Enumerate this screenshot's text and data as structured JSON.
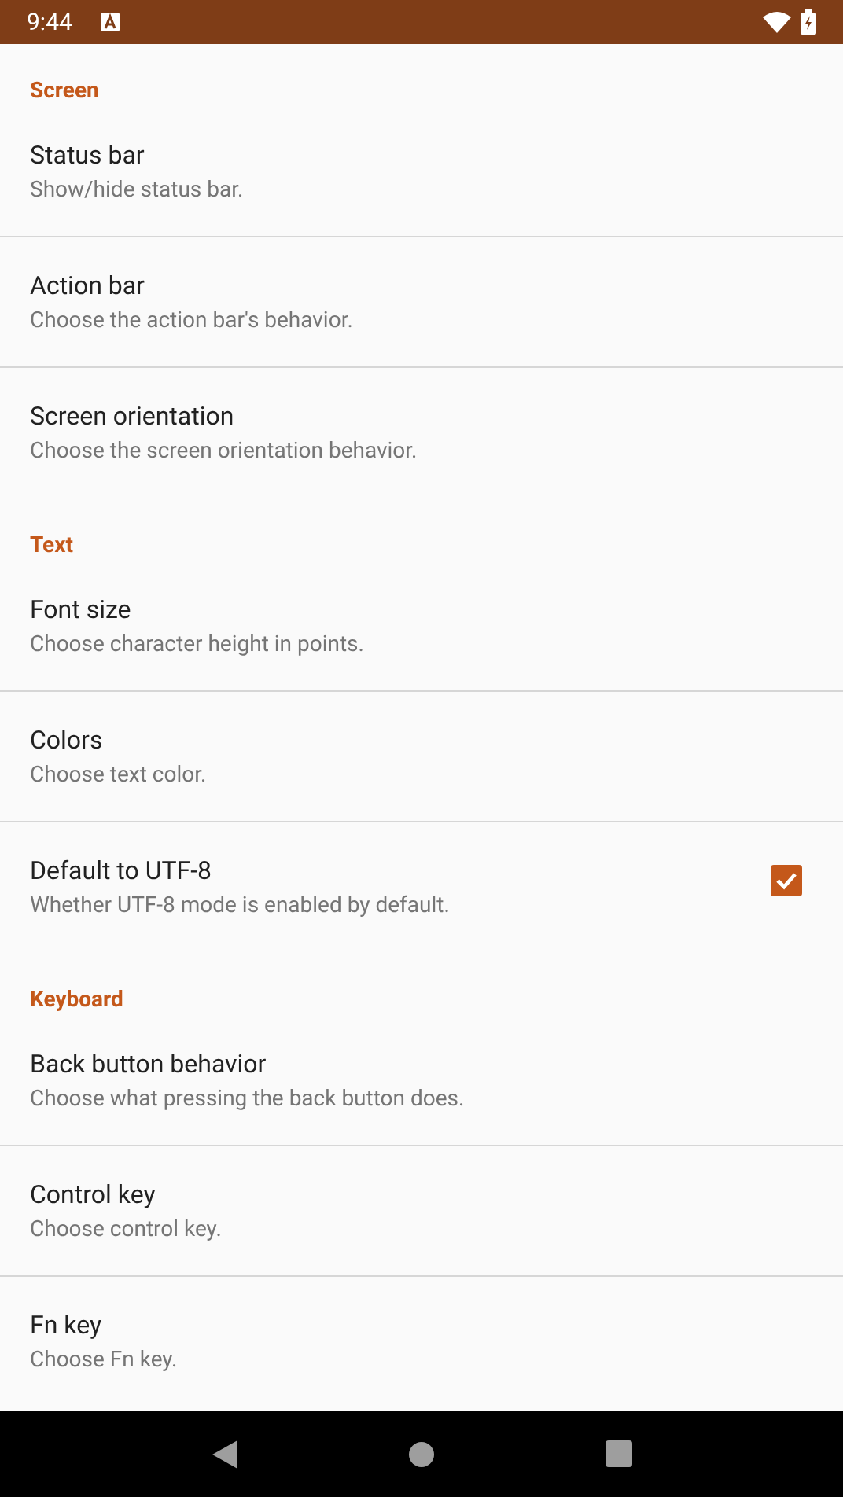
{
  "status_bar": {
    "time": "9:44"
  },
  "sections": [
    {
      "title": "Screen",
      "items": [
        {
          "kind": "plain",
          "title": "Status bar",
          "subtitle": "Show/hide status bar."
        },
        {
          "kind": "plain",
          "title": "Action bar",
          "subtitle": "Choose the action bar's behavior."
        },
        {
          "kind": "plain",
          "title": "Screen orientation",
          "subtitle": "Choose the screen orientation behavior."
        }
      ]
    },
    {
      "title": "Text",
      "items": [
        {
          "kind": "plain",
          "title": "Font size",
          "subtitle": "Choose character height in points."
        },
        {
          "kind": "plain",
          "title": "Colors",
          "subtitle": "Choose text color."
        },
        {
          "kind": "checkbox",
          "title": "Default to UTF-8",
          "subtitle": "Whether UTF-8 mode is enabled by default.",
          "checked": true
        }
      ]
    },
    {
      "title": "Keyboard",
      "items": [
        {
          "kind": "plain",
          "title": "Back button behavior",
          "subtitle": "Choose what pressing the back button does."
        },
        {
          "kind": "plain",
          "title": "Control key",
          "subtitle": "Choose control key."
        },
        {
          "kind": "plain",
          "title": "Fn key",
          "subtitle": "Choose Fn key."
        }
      ]
    }
  ]
}
